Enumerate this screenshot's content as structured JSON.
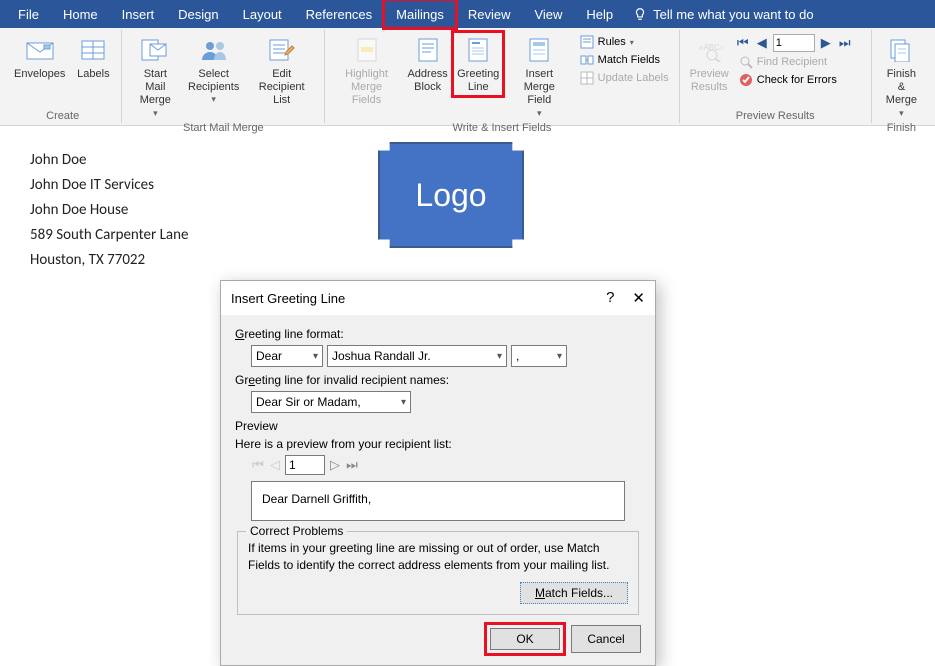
{
  "menu": {
    "file": "File",
    "home": "Home",
    "insert": "Insert",
    "design": "Design",
    "layout": "Layout",
    "references": "References",
    "mailings": "Mailings",
    "review": "Review",
    "view": "View",
    "help": "Help",
    "tell_me": "Tell me what you want to do"
  },
  "ribbon": {
    "create": {
      "label": "Create",
      "envelopes": "Envelopes",
      "labels": "Labels"
    },
    "start": {
      "label": "Start Mail Merge",
      "start_mail_merge": "Start Mail\nMerge",
      "select_recipients": "Select\nRecipients",
      "edit_recipient_list": "Edit\nRecipient List"
    },
    "write": {
      "label": "Write & Insert Fields",
      "highlight": "Highlight\nMerge Fields",
      "address_block": "Address\nBlock",
      "greeting_line": "Greeting\nLine",
      "insert_merge_field": "Insert Merge\nField",
      "rules": "Rules",
      "match_fields": "Match Fields",
      "update_labels": "Update Labels"
    },
    "preview": {
      "label": "Preview Results",
      "preview_results": "Preview\nResults",
      "record": "1",
      "find_recipient": "Find Recipient",
      "check_errors": "Check for Errors"
    },
    "finish": {
      "label": "Finish",
      "finish_merge": "Finish &\nMerge"
    }
  },
  "document": {
    "line1": "John Doe",
    "line2": "John Doe IT Services",
    "line3": "John Doe House",
    "line4": "589 South Carpenter Lane",
    "line5": "Houston, TX 77022",
    "logo": "Logo"
  },
  "dialog": {
    "title": "Insert Greeting Line",
    "format_label": "Greeting line format:",
    "format_salutation": "Dear",
    "format_name": "Joshua Randall Jr.",
    "format_punct": ",",
    "invalid_label": "Greeting line for invalid recipient names:",
    "invalid_value": "Dear Sir or Madam,",
    "preview_label": "Preview",
    "preview_hint": "Here is a preview from your recipient list:",
    "preview_record": "1",
    "preview_text": "Dear Darnell Griffith,",
    "problems_legend": "Correct Problems",
    "problems_text": "If items in your greeting line are missing or out of order, use Match Fields to identify the correct address elements from your mailing list.",
    "match_fields": "Match Fields...",
    "ok": "OK",
    "cancel": "Cancel"
  }
}
